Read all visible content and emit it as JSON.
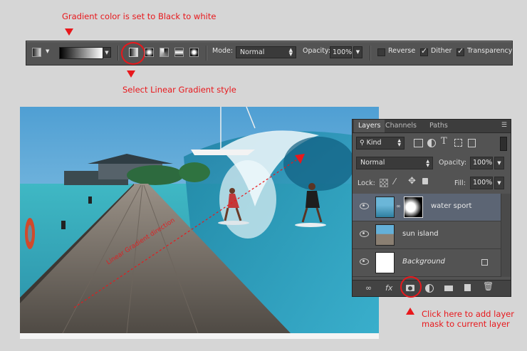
{
  "annotations": {
    "gradient_note": "Gradient color is set to Black to white",
    "linear_note": "Select Linear Gradient style",
    "mask_note_line1": "Click here to add layer",
    "mask_note_line2": "mask to current layer",
    "photo_text": "Linear Gradient direction"
  },
  "options_bar": {
    "mode_label": "Mode:",
    "mode_value": "Normal",
    "opacity_label": "Opacity:",
    "opacity_value": "100%",
    "reverse_label": "Reverse",
    "reverse_checked": false,
    "dither_label": "Dither",
    "dither_checked": true,
    "transparency_label": "Transparency",
    "transparency_checked": true,
    "gradient_styles": [
      "linear-gradient-icon",
      "radial-gradient-icon",
      "angle-gradient-icon",
      "reflected-gradient-icon",
      "diamond-gradient-icon"
    ]
  },
  "layers_panel": {
    "tabs": [
      "Layers",
      "Channels",
      "Paths"
    ],
    "active_tab": "Layers",
    "filter_kind": "Kind",
    "blend_mode": "Normal",
    "opacity_label": "Opacity:",
    "opacity_value": "100%",
    "lock_label": "Lock:",
    "fill_label": "Fill:",
    "fill_value": "100%",
    "layers": [
      {
        "name": "water sport",
        "selected": true,
        "has_mask": true
      },
      {
        "name": "sun island",
        "selected": false,
        "has_mask": false
      },
      {
        "name": "Background",
        "selected": false,
        "locked": true
      }
    ],
    "bottom_icons": [
      "link-icon",
      "fx-icon",
      "add-mask-icon",
      "adjustment-icon",
      "folder-icon",
      "new-layer-icon",
      "trash-icon"
    ],
    "fx_label": "fx"
  },
  "colors": {
    "accent_red": "#e8181c",
    "panel_bg": "#535353",
    "selected_layer": "#5c6574"
  }
}
